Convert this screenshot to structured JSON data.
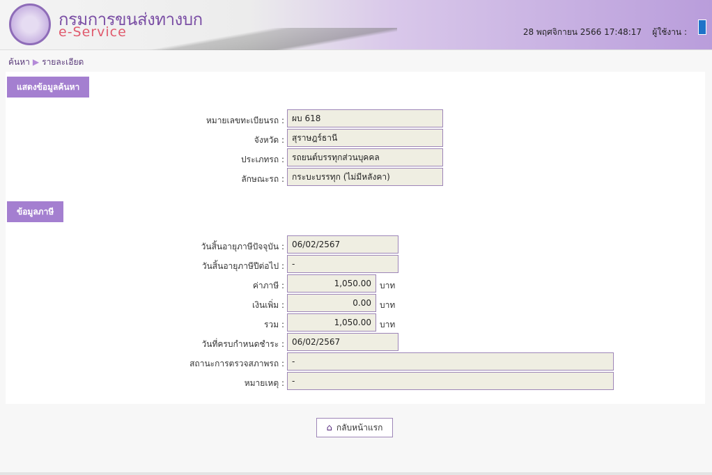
{
  "header": {
    "org": "กรมการขนส่งทางบก",
    "service": "e-Service",
    "datetime": "28 พฤศจิกายน 2566 17:48:17",
    "user_label": "ผู้ใช้งาน :"
  },
  "breadcrumb": {
    "search": "ค้นหา",
    "detail": "รายละเอียด"
  },
  "vehicle": {
    "title": "แสดงข้อมูลค้นหา",
    "fields": [
      {
        "label": "หมายเลขทะเบียนรถ :",
        "value": "ผบ 618"
      },
      {
        "label": "จังหวัด :",
        "value": "สุราษฎร์ธานี"
      },
      {
        "label": "ประเภทรถ :",
        "value": "รถยนต์บรรทุกส่วนบุคคล"
      },
      {
        "label": "ลักษณะรถ :",
        "value": "กระบะบรรทุก (ไม่มีหลังคา)"
      }
    ]
  },
  "tax": {
    "title": "ข้อมูลภาษี",
    "unit": "บาท",
    "fields": [
      {
        "label": "วันสิ้นอายุภาษีปัจจุบัน :",
        "value": "06/02/2567"
      },
      {
        "label": "วันสิ้นอายุภาษีปีต่อไป :",
        "value": "-"
      },
      {
        "label": "ค่าภาษี :",
        "value": "1,050.00"
      },
      {
        "label": "เงินเพิ่ม :",
        "value": "0.00"
      },
      {
        "label": "รวม :",
        "value": "1,050.00"
      },
      {
        "label": "วันที่ครบกำหนดชำระ :",
        "value": "06/02/2567"
      },
      {
        "label": "สถานะการตรวจสภาพรถ :",
        "value": "-"
      },
      {
        "label": "หมายเหตุ :",
        "value": "-"
      }
    ]
  },
  "home_button": "กลับหน้าแรก"
}
